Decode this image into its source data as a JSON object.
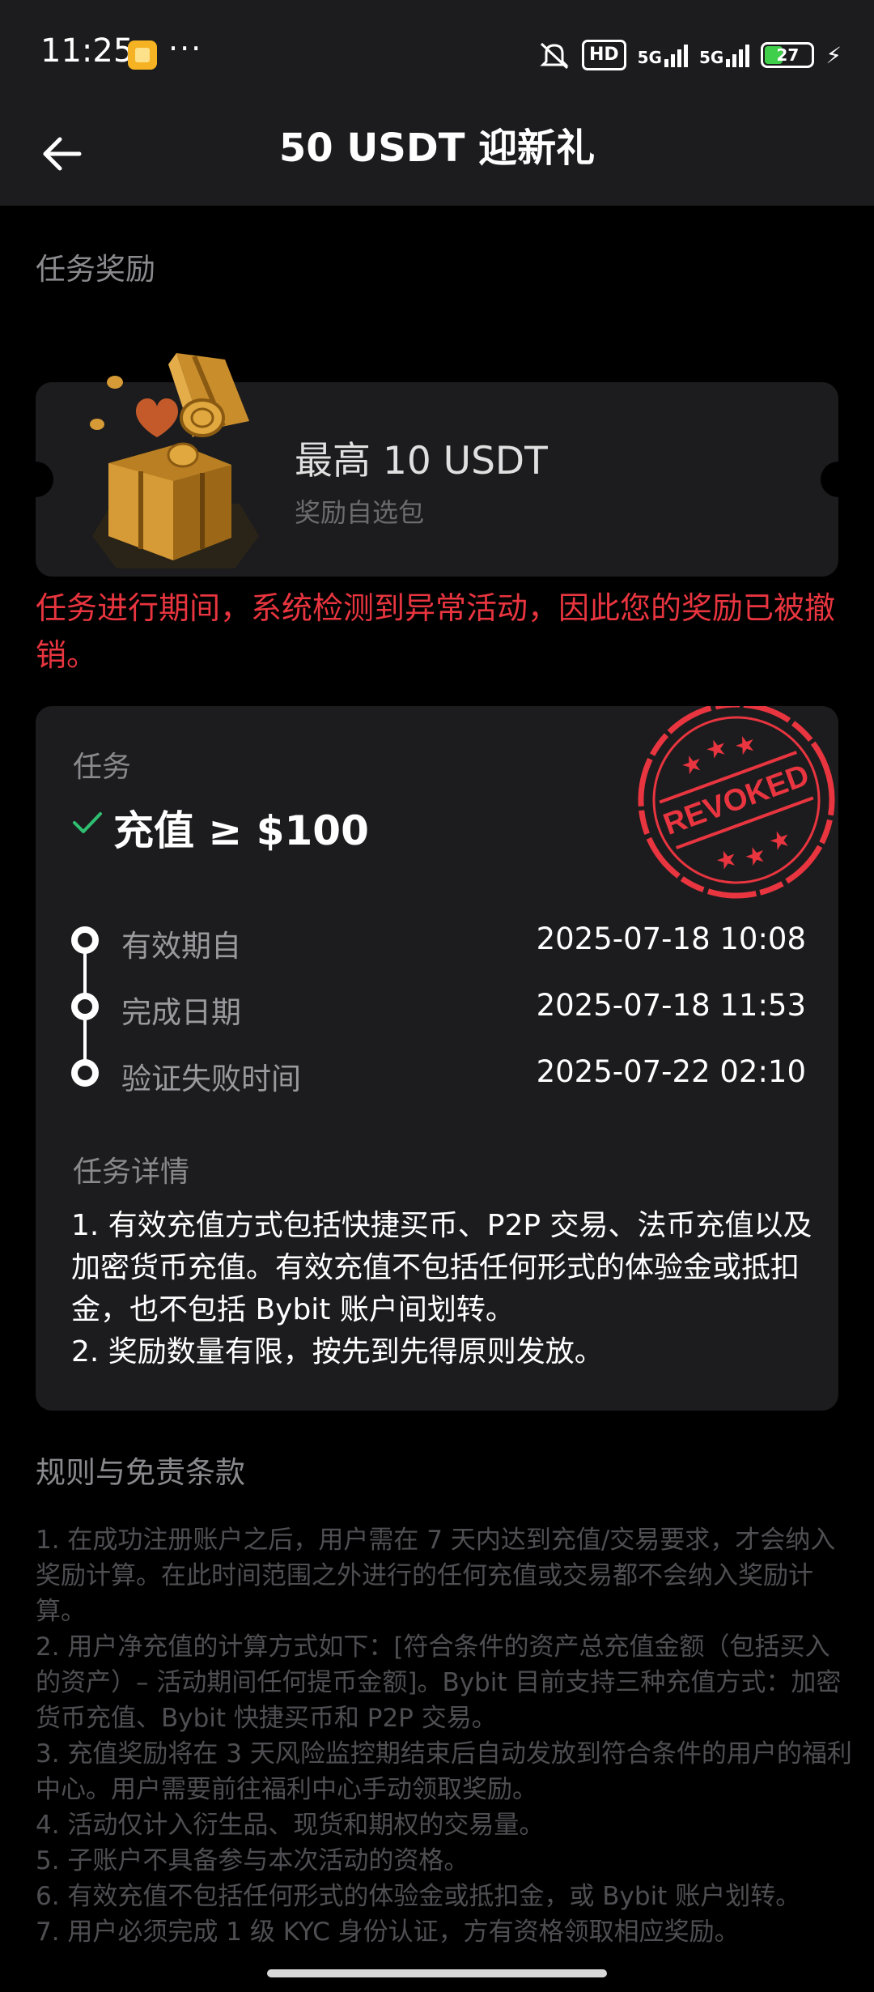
{
  "status_bar": {
    "time": "11:25",
    "dots": "···",
    "hd_label": "HD",
    "net1": "5G",
    "net2": "5G",
    "battery": "27"
  },
  "nav": {
    "title": "50 USDT 迎新礼",
    "back_icon": "arrow-left-icon"
  },
  "reward_section": {
    "label": "任务奖励",
    "title": "最高 10 USDT",
    "subtitle": "奖励自选包"
  },
  "warning": "任务进行期间，系统检测到异常活动，因此您的奖励已被撤销。",
  "task": {
    "label": "任务",
    "name": "充值 ≥ $100",
    "stamp_text": "REVOKED",
    "timeline": [
      {
        "label": "有效期自",
        "value": "2025-07-18 10:08"
      },
      {
        "label": "完成日期",
        "value": "2025-07-18 11:53"
      },
      {
        "label": "验证失败时间",
        "value": "2025-07-22 02:10"
      }
    ],
    "detail_label": "任务详情",
    "details": [
      "1. 有效充值方式包括快捷买币、P2P 交易、法币充值以及加密货币充值。有效充值不包括任何形式的体验金或抵扣金，也不包括 Bybit 账户间划转。",
      "2. 奖励数量有限，按先到先得原则发放。"
    ]
  },
  "rules": {
    "label": "规则与免责条款",
    "items": [
      "1. 在成功注册账户之后，用户需在 7 天内达到充值/交易要求，才会纳入奖励计算。在此时间范围之外进行的任何充值或交易都不会纳入奖励计算。",
      "2. 用户净充值的计算方式如下：[符合条件的资产总充值金额（包括买入的资产）– 活动期间任何提币金额]。Bybit 目前支持三种充值方式：加密货币充值、Bybit 快捷买币和 P2P 交易。",
      "3. 充值奖励将在 3 天风险监控期结束后自动发放到符合条件的用户的福利中心。用户需要前往福利中心手动领取奖励。",
      "4. 活动仅计入衍生品、现货和期权的交易量。",
      "5. 子账户不具备参与本次活动的资格。",
      "6. 有效充值不包括任何形式的体验金或抵扣金，或 Bybit 账户划转。",
      "7. 用户必须完成 1 级 KYC 身份认证，方有资格领取相应奖励。"
    ]
  },
  "colors": {
    "warning": "#e8353f",
    "stamp": "#e8353f",
    "check": "#2fbf71",
    "gift": "#c8902a"
  }
}
